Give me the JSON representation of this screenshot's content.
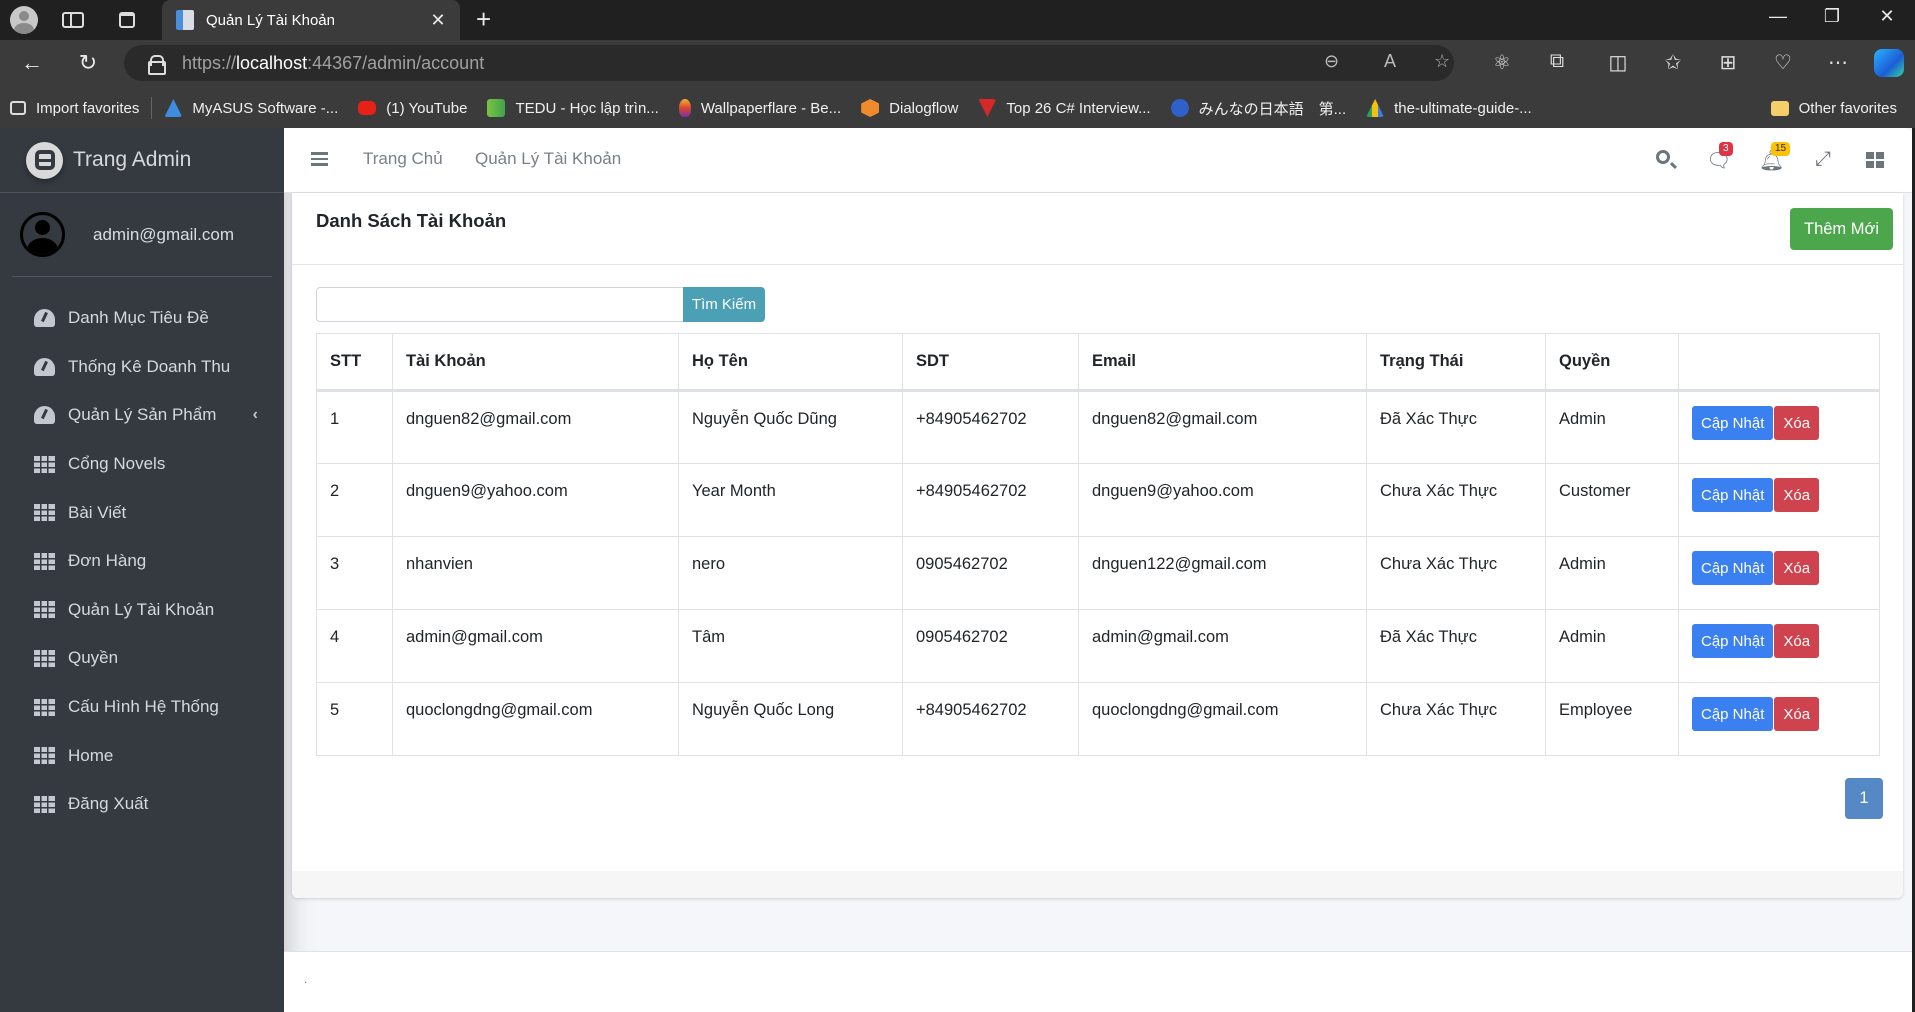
{
  "browser": {
    "tab_title": "Quản Lý Tài Khoản",
    "url_prefix": "https://",
    "url_host": "localhost",
    "url_rest": ":44367/admin/account",
    "bookmarks": [
      {
        "label": "Import favorites",
        "icon": "import-icon",
        "color": "#3b3b3b"
      },
      {
        "label": "MyASUS Software -...",
        "icon": "asus-icon",
        "color": "#3c8ce0"
      },
      {
        "label": "(1) YouTube",
        "icon": "youtube-icon",
        "color": "#e62117"
      },
      {
        "label": "TEDU - Học lập trìn...",
        "icon": "tedu-icon",
        "color": "#7cc342"
      },
      {
        "label": "Wallpaperflare - Be...",
        "icon": "wallpaperflare-icon",
        "color": "#d9462e"
      },
      {
        "label": "Dialogflow",
        "icon": "dialogflow-icon",
        "color": "#ef8b2c"
      },
      {
        "label": "Top 26 C# Interview...",
        "icon": "t-icon",
        "color": "#d62828"
      },
      {
        "label": "みんなの日本語　第...",
        "icon": "japanese-icon",
        "color": "#2e62c9"
      },
      {
        "label": "the-ultimate-guide-...",
        "icon": "drive-icon",
        "color": "#2aa05a"
      }
    ],
    "other_favorites": "Other favorites"
  },
  "sidebar": {
    "brand": "Trang Admin",
    "user": "admin@gmail.com",
    "items": [
      {
        "label": "Danh Mục Tiêu Đề",
        "icon": "gauge"
      },
      {
        "label": "Thống Kê Doanh Thu",
        "icon": "gauge"
      },
      {
        "label": "Quản Lý Sản Phẩm",
        "icon": "gauge",
        "has_children": true
      },
      {
        "label": "Cổng Novels",
        "icon": "grid"
      },
      {
        "label": "Bài Viết",
        "icon": "grid"
      },
      {
        "label": "Đơn Hàng",
        "icon": "grid"
      },
      {
        "label": "Quản Lý Tài Khoản",
        "icon": "grid"
      },
      {
        "label": "Quyền",
        "icon": "grid"
      },
      {
        "label": "Cấu Hình Hệ Thống",
        "icon": "grid"
      },
      {
        "label": "Home",
        "icon": "grid"
      },
      {
        "label": "Đăng Xuất",
        "icon": "grid"
      }
    ]
  },
  "header": {
    "links": [
      "Trang Chủ",
      "Quản Lý Tài Khoản"
    ],
    "messages_count": "3",
    "notifications_count": "15"
  },
  "card": {
    "title": "Danh Sách Tài Khoản",
    "add_button": "Thêm Mới",
    "search_placeholder": "",
    "search_value": "",
    "search_button": "Tìm Kiếm",
    "columns": [
      "STT",
      "Tài Khoản",
      "Họ Tên",
      "SDT",
      "Email",
      "Trạng Thái",
      "Quyền",
      ""
    ],
    "rows": [
      [
        "1",
        "dnguen82@gmail.com",
        "Nguyễn Quốc Dũng",
        "+84905462702",
        "dnguen82@gmail.com",
        "Đã Xác Thực",
        "Admin"
      ],
      [
        "2",
        "dnguen9@yahoo.com",
        "Year Month",
        "+84905462702",
        "dnguen9@yahoo.com",
        "Chưa Xác Thực",
        "Customer"
      ],
      [
        "3",
        "nhanvien",
        "nero",
        "0905462702",
        "dnguen122@gmail.com",
        "Chưa Xác Thực",
        "Admin"
      ],
      [
        "4",
        "admin@gmail.com",
        "Tâm",
        "0905462702",
        "admin@gmail.com",
        "Đã Xác Thực",
        "Admin"
      ],
      [
        "5",
        "quoclongdng@gmail.com",
        "Nguyễn Quốc Long",
        "+84905462702",
        "quoclongdng@gmail.com",
        "Chưa Xác Thực",
        "Employee"
      ]
    ],
    "update_button": "Cập Nhật",
    "delete_button": "Xóa",
    "current_page": "1"
  },
  "footer": {
    "text": "."
  },
  "colors": {
    "add": "#4ca64c",
    "update": "#3a80f0",
    "delete": "#cf434e",
    "search": "#4ca0b5",
    "page": "#5589c6",
    "sidebar": "#343a40"
  }
}
